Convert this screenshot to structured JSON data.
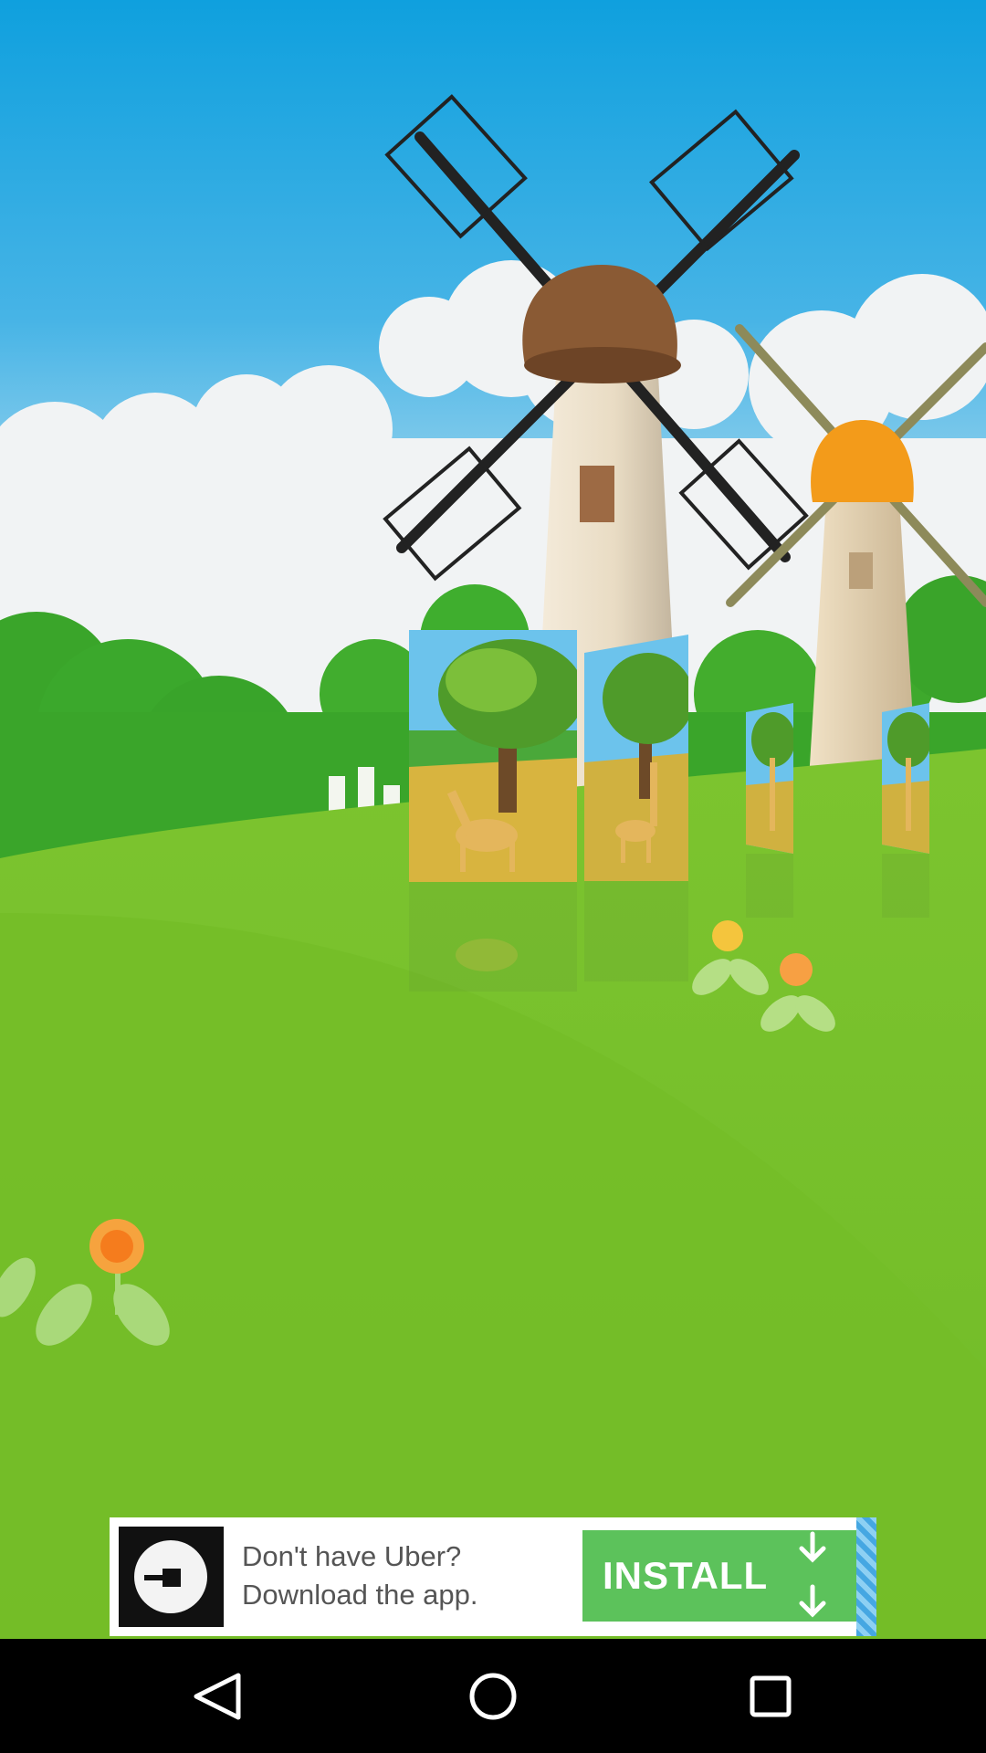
{
  "wallpaper": {
    "sky_top_color": "#1ba3de",
    "sky_bottom_color": "#7cc9ec",
    "grass_color": "#76c12b",
    "grass_dark_color": "#3aa520",
    "windmill_roof_color": "#8a5a34",
    "small_windmill_roof_color": "#f39b1a"
  },
  "carousel": {
    "cards": [
      {
        "subject": "giraffe drinking under tree"
      },
      {
        "subject": "giraffe standing under tree"
      },
      {
        "subject": "giraffe under tree"
      },
      {
        "subject": "giraffe under tree"
      }
    ]
  },
  "ad": {
    "line1": "Don't have Uber?",
    "line2": "Download the app.",
    "install_label": "INSTALL",
    "button_color": "#5cc25b"
  },
  "nav": {
    "back_icon": "back-triangle-icon",
    "home_icon": "home-circle-icon",
    "recents_icon": "recents-square-icon"
  }
}
